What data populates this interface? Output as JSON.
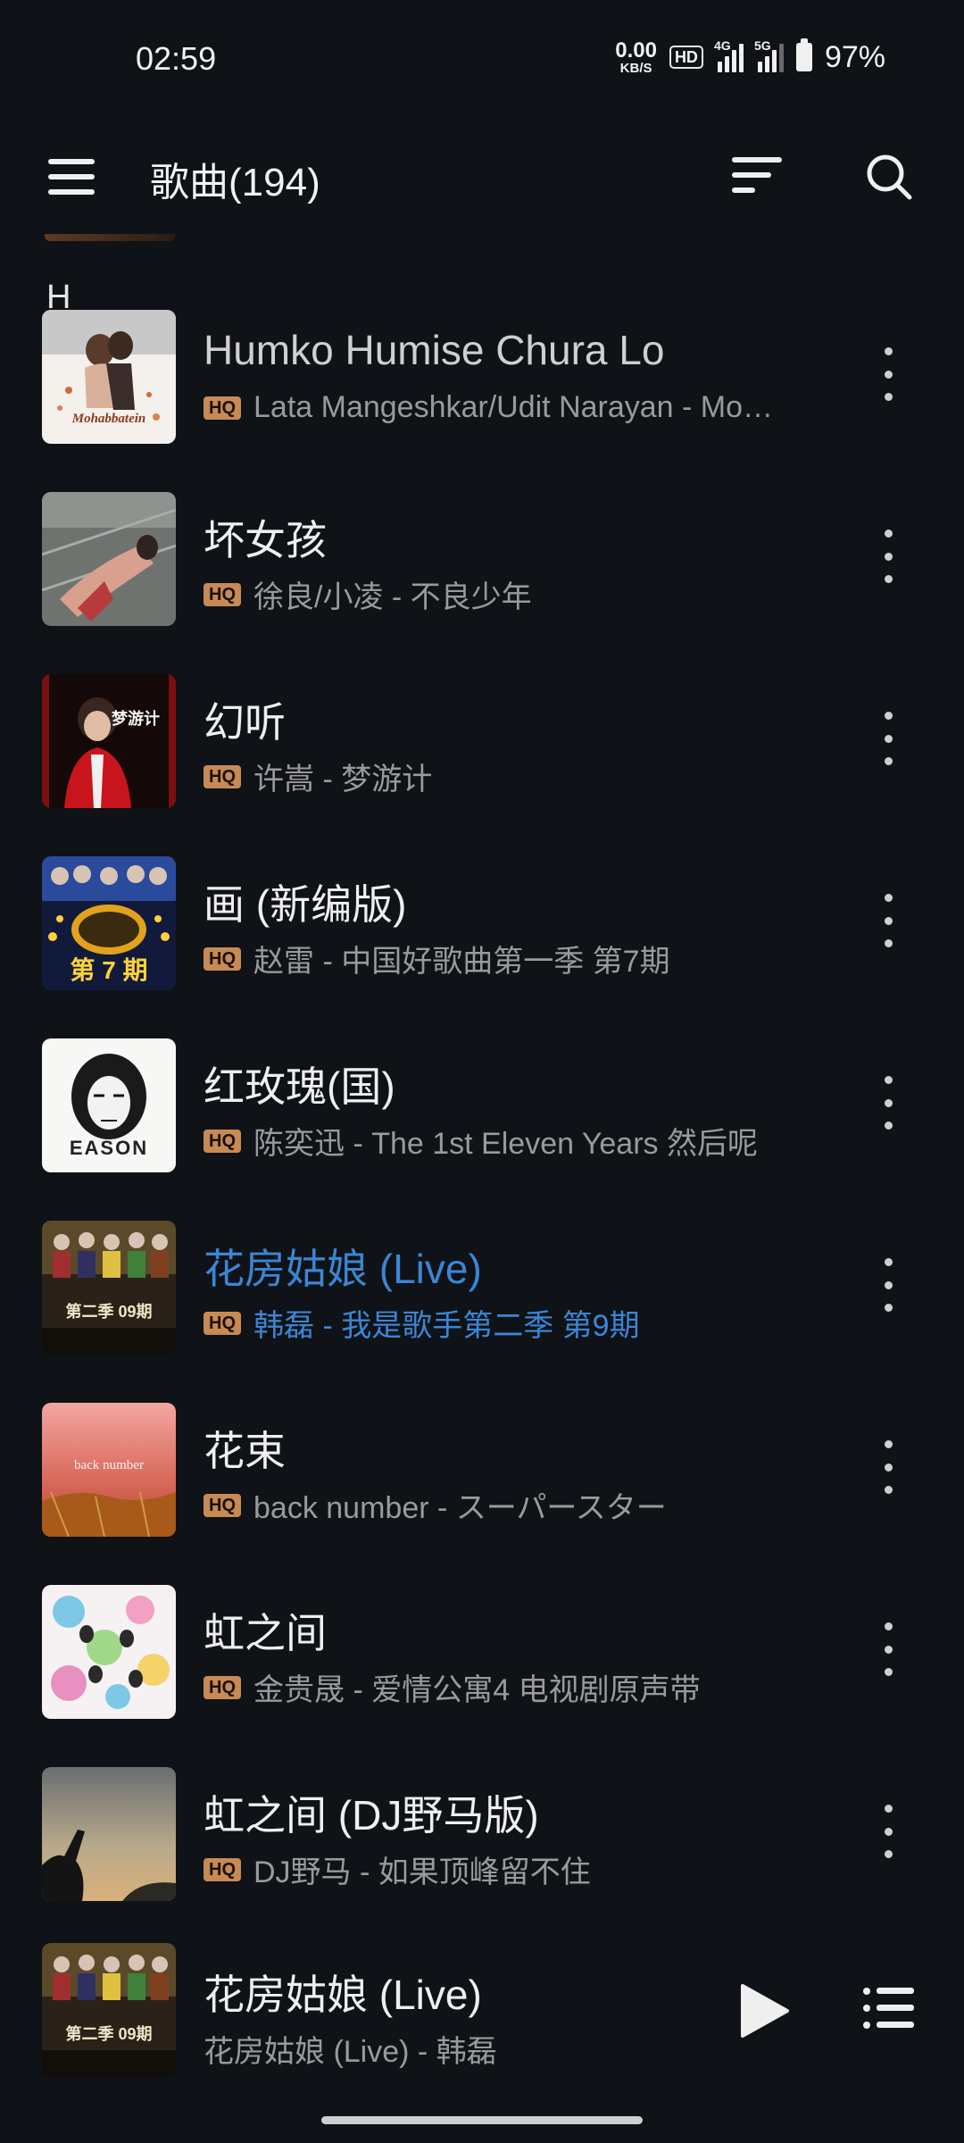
{
  "status_bar": {
    "time": "02:59",
    "net_speed_value": "0.00",
    "net_speed_unit": "KB/S",
    "hd_badge": "HD",
    "signal1_type": "4G",
    "signal2_type": "5G",
    "battery_percent": "97%"
  },
  "header": {
    "title": "歌曲(194)",
    "icons": [
      "menu-icon",
      "sort-icon",
      "search-icon"
    ]
  },
  "list": {
    "section_letter": "H",
    "quality_badge": "HQ",
    "songs": [
      {
        "title": "Humko Humise Chura Lo",
        "subtitle": "Lata Mangeshkar/Udit Narayan - Mohabbatein",
        "art_text": "Mohabbatein"
      },
      {
        "title": "坏女孩",
        "subtitle": "徐良/小凌 - 不良少年",
        "art_text": ""
      },
      {
        "title": "幻听",
        "subtitle": "许嵩 - 梦游计",
        "art_text": "梦游计"
      },
      {
        "title": "画 (新编版)",
        "subtitle": "赵雷 - 中国好歌曲第一季 第7期",
        "art_text": "第 7 期"
      },
      {
        "title": "红玫瑰(国)",
        "subtitle": "陈奕迅 - The 1st Eleven Years 然后呢",
        "art_text": "EASON"
      },
      {
        "title": "花房姑娘 (Live)",
        "subtitle": "韩磊 - 我是歌手第二季 第9期",
        "art_text": "第二季 09期"
      },
      {
        "title": "花束",
        "subtitle": "back number - スーパースター",
        "art_text": "back number"
      },
      {
        "title": "虹之间",
        "subtitle": "金贵晟 - 爱情公寓4 电视剧原声带",
        "art_text": ""
      },
      {
        "title": "虹之间 (DJ野马版)",
        "subtitle": "DJ野马 - 如果顶峰留不住",
        "art_text": ""
      }
    ],
    "playing_index": 5
  },
  "mini_player": {
    "title": "花房姑娘 (Live)",
    "subtitle": "花房姑娘 (Live) - 韩磊",
    "art_text": "第二季 09期"
  },
  "colors": {
    "background": "#0f1216",
    "accent_playing": "#3a86d6",
    "hq_badge": "#c78a55"
  }
}
